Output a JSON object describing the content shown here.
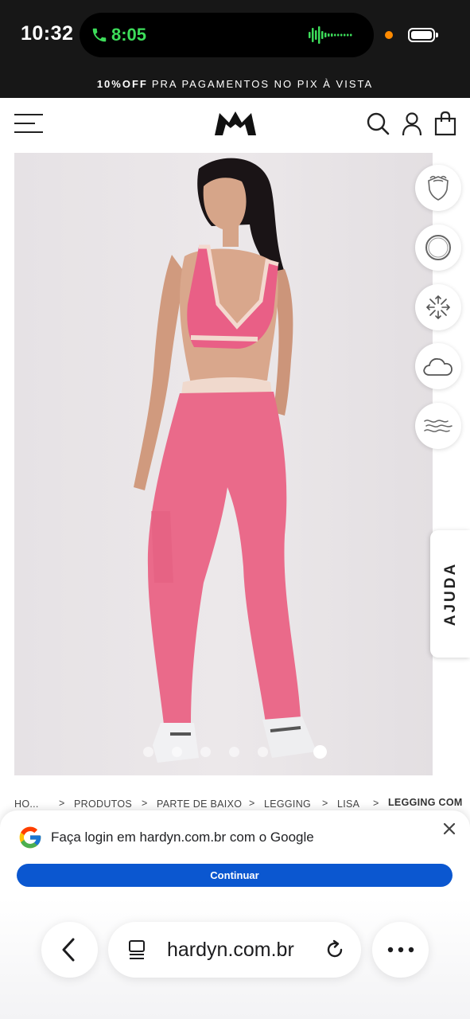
{
  "status_bar": {
    "time": "10:32",
    "call_timer": "8:05",
    "icons": [
      "phone-icon",
      "audio-wave-icon",
      "camera-indicator-dot",
      "battery-icon"
    ],
    "colors": {
      "call_green": "#3ddc5a",
      "indicator_orange": "#ff8a00"
    }
  },
  "promo": {
    "highlight": "10%OFF",
    "text": "PRA PAGAMENTOS NO PIX À VISTA"
  },
  "header": {
    "icons": [
      "menu-icon",
      "crown-logo",
      "search-icon",
      "user-icon",
      "bag-icon"
    ]
  },
  "gallery": {
    "dot_count": 6,
    "active_index": 5,
    "feature_icons": [
      "shield-flame-icon",
      "ring-icon",
      "stretch-arrows-icon",
      "cloud-icon",
      "wind-waves-icon"
    ]
  },
  "help_tab": {
    "label": "AJUDA"
  },
  "breadcrumb": {
    "items": [
      "HO...",
      "PRODUTOS",
      "PARTE DE BAIXO",
      "LEGGING",
      "LISA",
      "LEGGING COM"
    ],
    "separator": ">"
  },
  "google_signin": {
    "message": "Faça login em hardyn.com.br com o Google",
    "button": "Continuar",
    "colors": {
      "button_blue": "#0b57d0"
    }
  },
  "browser": {
    "url": "hardyn.com.br",
    "icons": [
      "back-chevron-icon",
      "reader-icon",
      "reload-icon",
      "more-dots-icon"
    ]
  }
}
